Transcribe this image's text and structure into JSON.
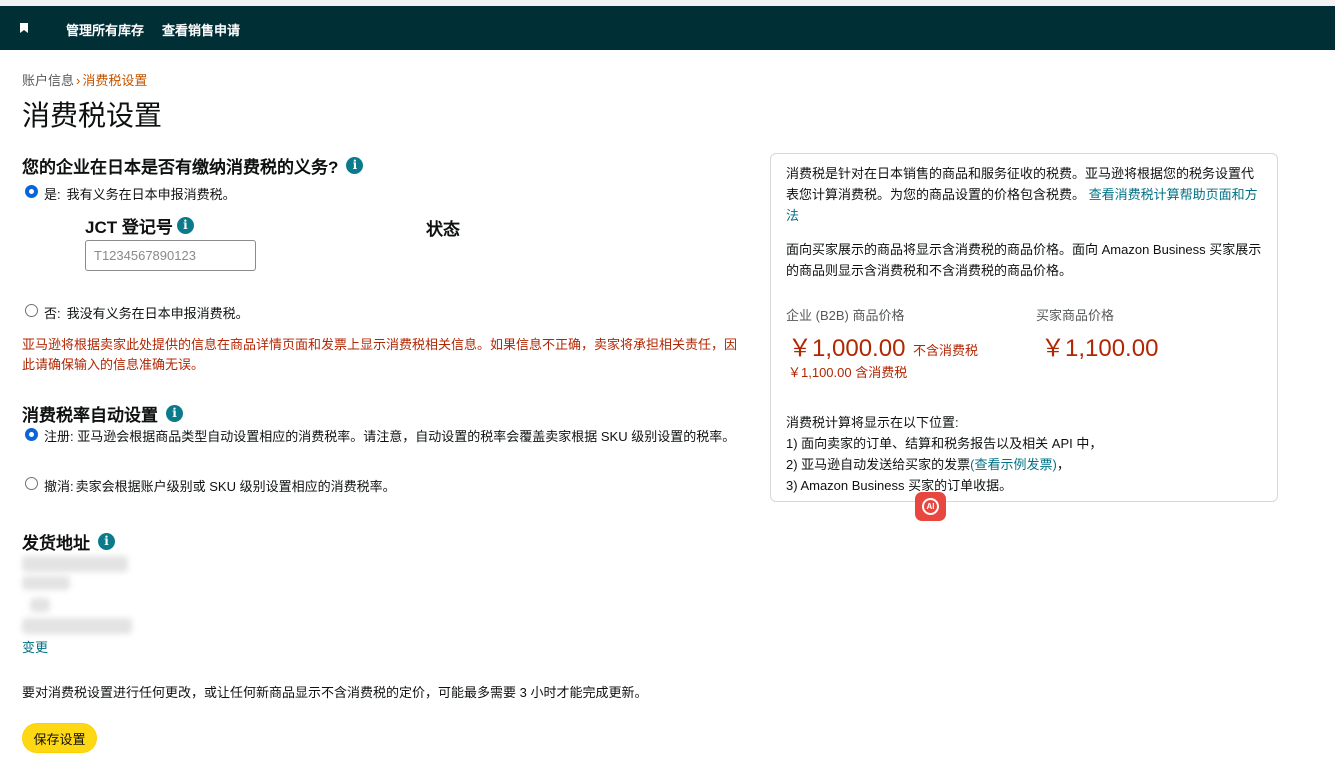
{
  "topnav": {
    "links": [
      "管理所有库存",
      "查看销售申请"
    ]
  },
  "breadcrumb": {
    "parent": "账户信息",
    "separator": "›",
    "current": "消费税设置"
  },
  "page_title": "消费税设置",
  "obligation": {
    "heading": "您的企业在日本是否有缴纳消费税的义务?",
    "yes_prefix": "是:",
    "yes_label": "我有义务在日本申报消费税。",
    "jct_label": "JCT 登记号",
    "status_label": "状态",
    "jct_placeholder": "T1234567890123",
    "no_prefix": "否:",
    "no_label": "我没有义务在日本申报消费税。",
    "warning": "亚马逊将根据卖家此处提供的信息在商品详情页面和发票上显示消费税相关信息。如果信息不正确，卖家将承担相关责任，因此请确保输入的信息准确无误。"
  },
  "auto_rate": {
    "heading": "消费税率自动设置",
    "register_prefix": "注册:",
    "register_label": "亚马逊会根据商品类型自动设置相应的消费税率。请注意，自动设置的税率会覆盖卖家根据 SKU 级别设置的税率。",
    "cancel_prefix": "撤消:",
    "cancel_label": "卖家会根据账户级别或 SKU 级别设置相应的消费税率。"
  },
  "shipping": {
    "heading": "发货地址",
    "change_link": "变更"
  },
  "update_note": "要对消费税设置进行任何更改，或让任何新商品显示不含消费税的定价，可能最多需要 3 小时才能完成更新。",
  "save_button": "保存设置",
  "side_panel": {
    "intro": "消费税是针对在日本销售的商品和服务征收的税费。亚马逊将根据您的税务设置代表您计算消费税。为您的商品设置的价格包含税费。",
    "intro_link": "查看消费税计算帮助页面和方法",
    "display_info": "面向买家展示的商品将显示含消费税的商品价格。面向 Amazon Business 买家展示的商品则显示含消费税和不含消费税的商品价格。",
    "b2b_label": "企业 (B2B) 商品价格",
    "b2b_price": "￥1,000.00",
    "b2b_tax_excl": "不含消费税",
    "b2b_price_incl": "￥1,100.00 含消费税",
    "buyer_label": "买家商品价格",
    "buyer_price": "￥1,100.00",
    "calc_heading": "消费税计算将显示在以下位置:",
    "calc_item1": "1) 面向卖家的订单、结算和税务报告以及相关 API 中，",
    "calc_item2_pre": "2) 亚马逊自动发送给买家的发票",
    "calc_item2_link": "(查看示例发票)",
    "calc_item2_post": "，",
    "calc_item3": "3) Amazon Business 买家的订单收据。"
  },
  "ai_badge": "AI",
  "colors": {
    "nav_bg": "#002f36",
    "accent_orange": "#c45500",
    "price_red": "#b12704",
    "link_teal": "#007185",
    "button_yellow": "#ffd814"
  }
}
